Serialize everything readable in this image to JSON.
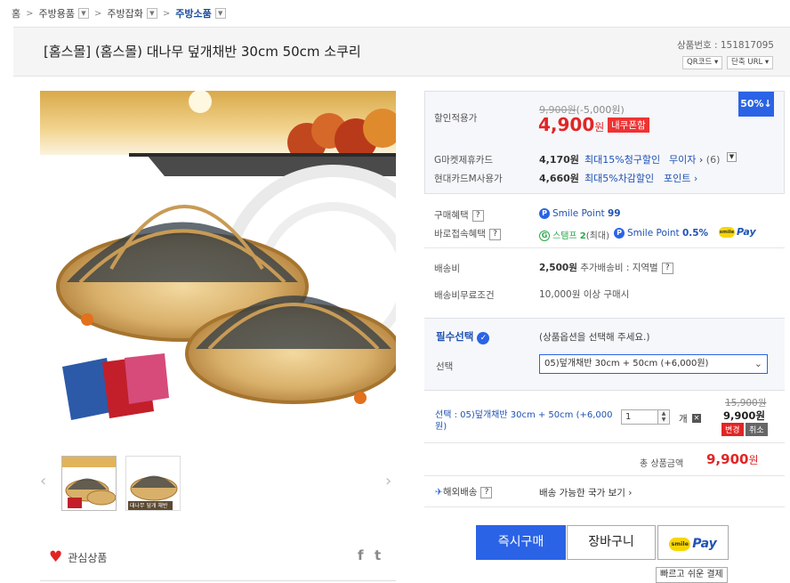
{
  "breadcrumb": {
    "home": "홈",
    "level1": "주방용품",
    "level2": "주방잡화",
    "current": "주방소품"
  },
  "product": {
    "title": "[홈스몰] (홈스몰) 대나무 덮개채반 30cm 50cm 소쿠리",
    "number_label": "상품번호 : 151817095",
    "qr_label": "QR코드",
    "short_url_label": "단축 URL"
  },
  "gallery": {
    "thumb2_caption": "대나무 덮개 채반"
  },
  "wishlist": {
    "label": "관심상품",
    "share_f": "f",
    "share_t": "t"
  },
  "pricing": {
    "discount_label": "할인적용가",
    "original_price": "9,900원",
    "discount_amount": "(-5,000원)",
    "sale_price": "4,900",
    "sale_unit": "원",
    "tag": "내쿠폰함",
    "discount_badge": "50%↓",
    "card1_label": "G마켓제휴카드",
    "card1_price": "4,170원",
    "card1_desc": "최대15%청구할인",
    "card1_extra": "무이자",
    "card1_extra_count": "(6)",
    "card2_label": "현대카드M사용가",
    "card2_price": "4,660원",
    "card2_desc": "최대5%차감할인",
    "card2_extra": "포인트"
  },
  "benefits": {
    "purchase_label": "구매혜택",
    "smile_point_label": "Smile Point",
    "smile_point_value": "99",
    "direct_label": "바로접속혜택",
    "stamp_label": "스탬프",
    "stamp_value": "2",
    "stamp_suffix": "(최대)",
    "smile_point2_label": "Smile Point",
    "smile_point2_value": "0.5%",
    "smilepay_label": "Pay",
    "smilepay_dot": "smile"
  },
  "shipping": {
    "fee_label": "배송비",
    "fee_value": "2,500원",
    "fee_extra": "추가배송비 : 지역별",
    "free_label": "배송비무료조건",
    "free_value": "10,000원 이상 구매시"
  },
  "options": {
    "required_label": "필수선택",
    "required_hint": "(상품옵션을 선택해 주세요.)",
    "select_label": "선택",
    "selected_value": "05)덮개채반 30cm + 50cm (+6,000원)"
  },
  "selection": {
    "line": "선택 : 05)덮개채반 30cm + 50cm (+6,000원)",
    "qty": "1",
    "qty_unit": "개",
    "orig_price": "15,900원",
    "price": "9,900원",
    "change_label": "변경",
    "cancel_label": "취소"
  },
  "total": {
    "label": "총 상품금액",
    "value": "9,900",
    "unit": "원"
  },
  "overseas": {
    "label": "해외배송",
    "link": "배송 가능한 국가 보기"
  },
  "actions": {
    "buy_now": "즉시구매",
    "cart": "장바구니",
    "smilepay_dot": "smile",
    "smilepay": "Pay",
    "tooltip": "빠르고 쉬운 결제"
  }
}
